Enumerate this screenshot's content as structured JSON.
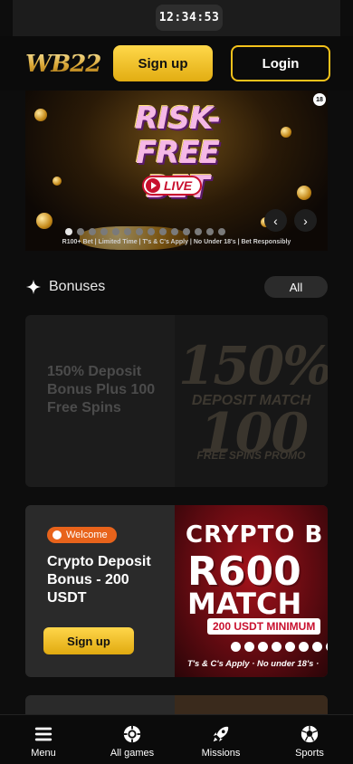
{
  "status_bar": {
    "time": "12:34:53"
  },
  "header": {
    "logo_text": "WB22",
    "signup_label": "Sign up",
    "login_label": "Login",
    "accent_color": "#f4c21b"
  },
  "banner": {
    "title_line1": "RISK-FREE",
    "title_line2": "BET",
    "live_label": "LIVE",
    "age_badge": "18",
    "disclaimer": "R100+ Bet | Limited Time | T's & C's Apply | No Under 18's | Bet Responsibly",
    "slide_count": 14,
    "active_slide": 1,
    "prev_icon": "chevron-left-icon",
    "next_icon": "chevron-right-icon"
  },
  "bonuses": {
    "section_title": "Bonuses",
    "all_label": "All",
    "cards": [
      {
        "title": "150% Deposit Bonus Plus 100 Free Spins",
        "promo_big_1": "150%",
        "promo_sub_1": "DEPOSIT MATCH",
        "promo_big_2": "100",
        "promo_sub_2": "FREE SPINS PROMO",
        "disabled": true
      },
      {
        "badge": "Welcome",
        "title": "Crypto Deposit Bonus - 200 USDT",
        "button_label": "Sign up",
        "promo_line1": "CRYPTO B",
        "promo_line2": "R600",
        "promo_line3": "MATCH",
        "promo_minimum": "200 USDT MINIMUM",
        "promo_terms": "T's & C's Apply · No under 18's ·"
      }
    ]
  },
  "bottom_nav": {
    "items": [
      {
        "label": "Menu",
        "icon": "menu-icon"
      },
      {
        "label": "All games",
        "icon": "chip-icon"
      },
      {
        "label": "Missions",
        "icon": "rocket-icon"
      },
      {
        "label": "Sports",
        "icon": "soccer-ball-icon"
      }
    ]
  }
}
